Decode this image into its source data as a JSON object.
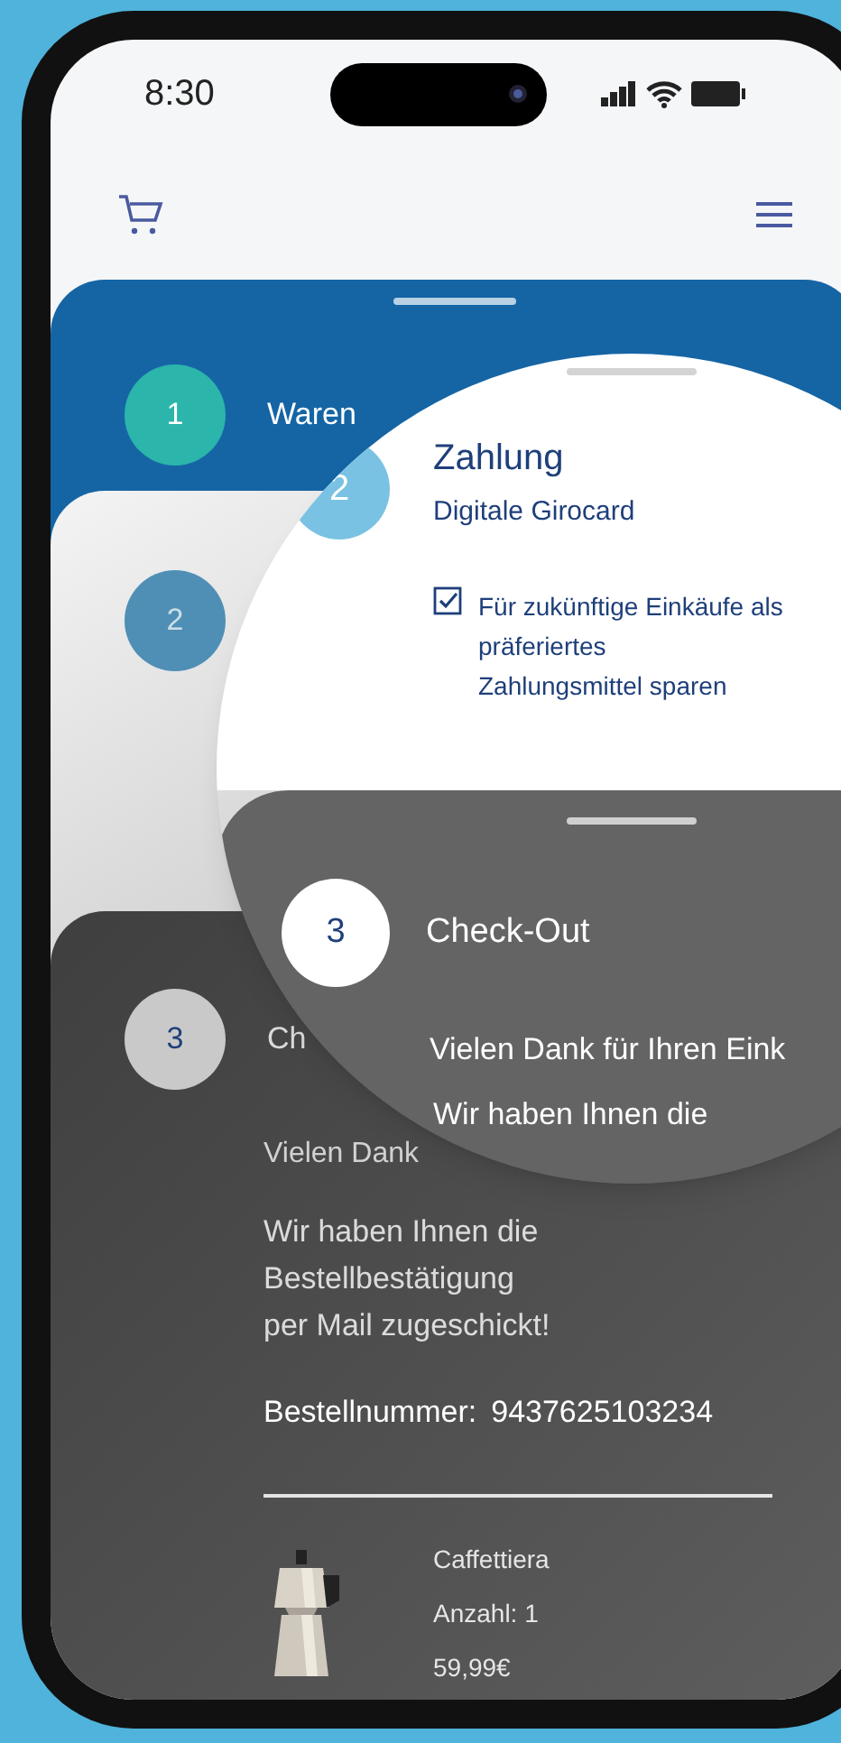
{
  "status_bar": {
    "time": "8:30"
  },
  "steps": [
    {
      "kind": "cart",
      "number": "1",
      "label": "Waren",
      "color": "#2bb5ab"
    },
    {
      "kind": "payment",
      "number": "2",
      "color": "#4f8fb5"
    },
    {
      "kind": "checkout",
      "number": "3",
      "label": "Ch",
      "color": "#c9c9c9",
      "thanks": "Vielen Dank",
      "message": "Wir haben Ihnen die\nBestellbestätigung\nper Mail zugeschickt!",
      "order_number_label": "Bestellnummer:",
      "order_number": "9437625103234",
      "product": {
        "name": "Caffettiera",
        "quantity": "Anzahl: 1",
        "price": "59,99€"
      }
    }
  ],
  "magnifier": {
    "payment": {
      "number": "2",
      "title": "Zahlung",
      "method": "Digitale Girocard",
      "save_option": {
        "label": "Für zukünftige Einkäufe als\npräferiertes\nZahlungsmittel sparen",
        "checked": true
      }
    },
    "checkout": {
      "number": "3",
      "title": "Check-Out",
      "thanks": "Vielen Dank für Ihren Eink",
      "message": "Wir haben Ihnen die"
    }
  }
}
